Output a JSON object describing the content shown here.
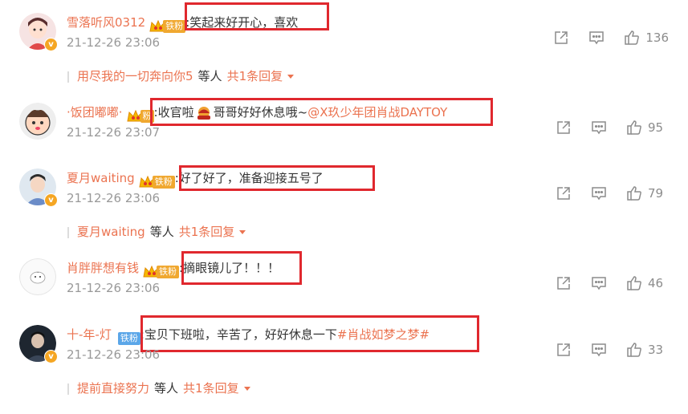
{
  "colors": {
    "accent": "#eb7350",
    "highlight": "#e0282e",
    "muted": "#999999",
    "badge_gold": "#f0a830",
    "badge_blue": "#5ba6e8"
  },
  "comments": [
    {
      "username": "雪落听风0312",
      "fan_badge": "铁粉",
      "text": ":笑起来好开心，喜欢",
      "mention": "",
      "time": "21-12-26 23:06",
      "likes": "136",
      "reply": {
        "name": "用尽我的一切奔向你5",
        "others": "等人",
        "count": "共1条回复"
      }
    },
    {
      "username": "·饭团嘟嘟·",
      "fan_badge": "粉",
      "text": ":收官啦",
      "text2": "哥哥好好休息哦~",
      "mention": "@X玖少年团肖战DAYTOY",
      "time": "21-12-26 23:07",
      "likes": "95"
    },
    {
      "username": "夏月waiting",
      "fan_badge": "铁粉",
      "text": ":好了好了，准备迎接五号了",
      "mention": "",
      "time": "21-12-26 23:06",
      "likes": "79",
      "reply": {
        "name": "夏月waiting",
        "others": "等人",
        "count": "共1条回复"
      }
    },
    {
      "username": "肖胖胖想有钱",
      "fan_badge": "铁粉",
      "text": ":摘眼镜儿了！！！",
      "mention": "",
      "time": "21-12-26 23:06",
      "likes": "46"
    },
    {
      "username": "十-年-灯",
      "fan_badge": "铁粉",
      "text": ":宝贝下班啦，辛苦了，好好休息一下",
      "mention": "#肖战如梦之梦#",
      "time": "21-12-26 23:06",
      "likes": "33",
      "reply": {
        "name": "提前直接努力",
        "others": "等人",
        "count": "共1条回复"
      }
    }
  ],
  "icons": {
    "share": "share-icon",
    "comment": "comment-icon",
    "like": "like-icon"
  }
}
